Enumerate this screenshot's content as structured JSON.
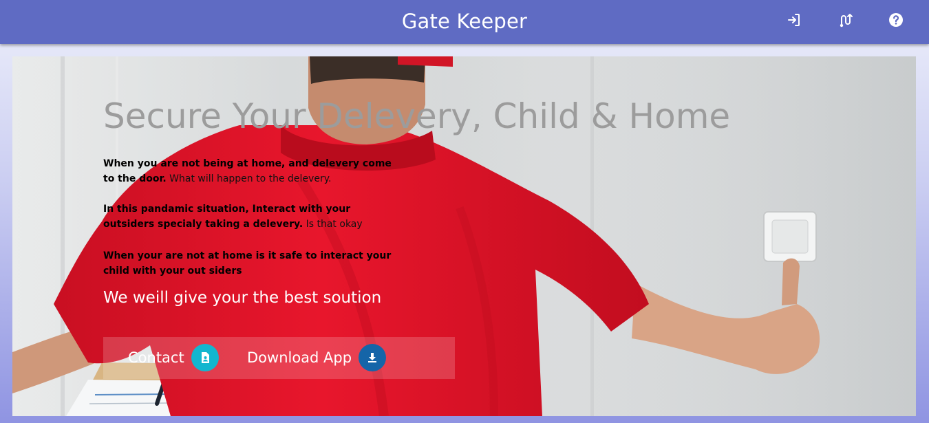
{
  "header": {
    "title": "Gate Keeper",
    "icons": [
      "login-icon",
      "route-icon",
      "help-icon"
    ]
  },
  "hero": {
    "headline": "Secure Your Delevery, Child & Home",
    "paragraphs": [
      {
        "bold": "When you are not being at home, and delevery come to the door.",
        "normal": " What will happen to the delevery."
      },
      {
        "bold": "In this pandamic situation, Interact with your outsiders specialy taking a delevery.",
        "normal": " Is that okay"
      },
      {
        "bold": "When your are not at home is it safe to interact your child with your out siders",
        "normal": ""
      }
    ],
    "solution_text": "We weill give your the best soution",
    "buttons": {
      "contact_label": "Contact",
      "download_label": "Download App"
    }
  },
  "colors": {
    "topbar": "#5f6bc3",
    "contact_accent": "#13b6cf",
    "download_accent": "#1565a8",
    "headline": "#9c9c9c",
    "shirt": "#e2142b"
  }
}
